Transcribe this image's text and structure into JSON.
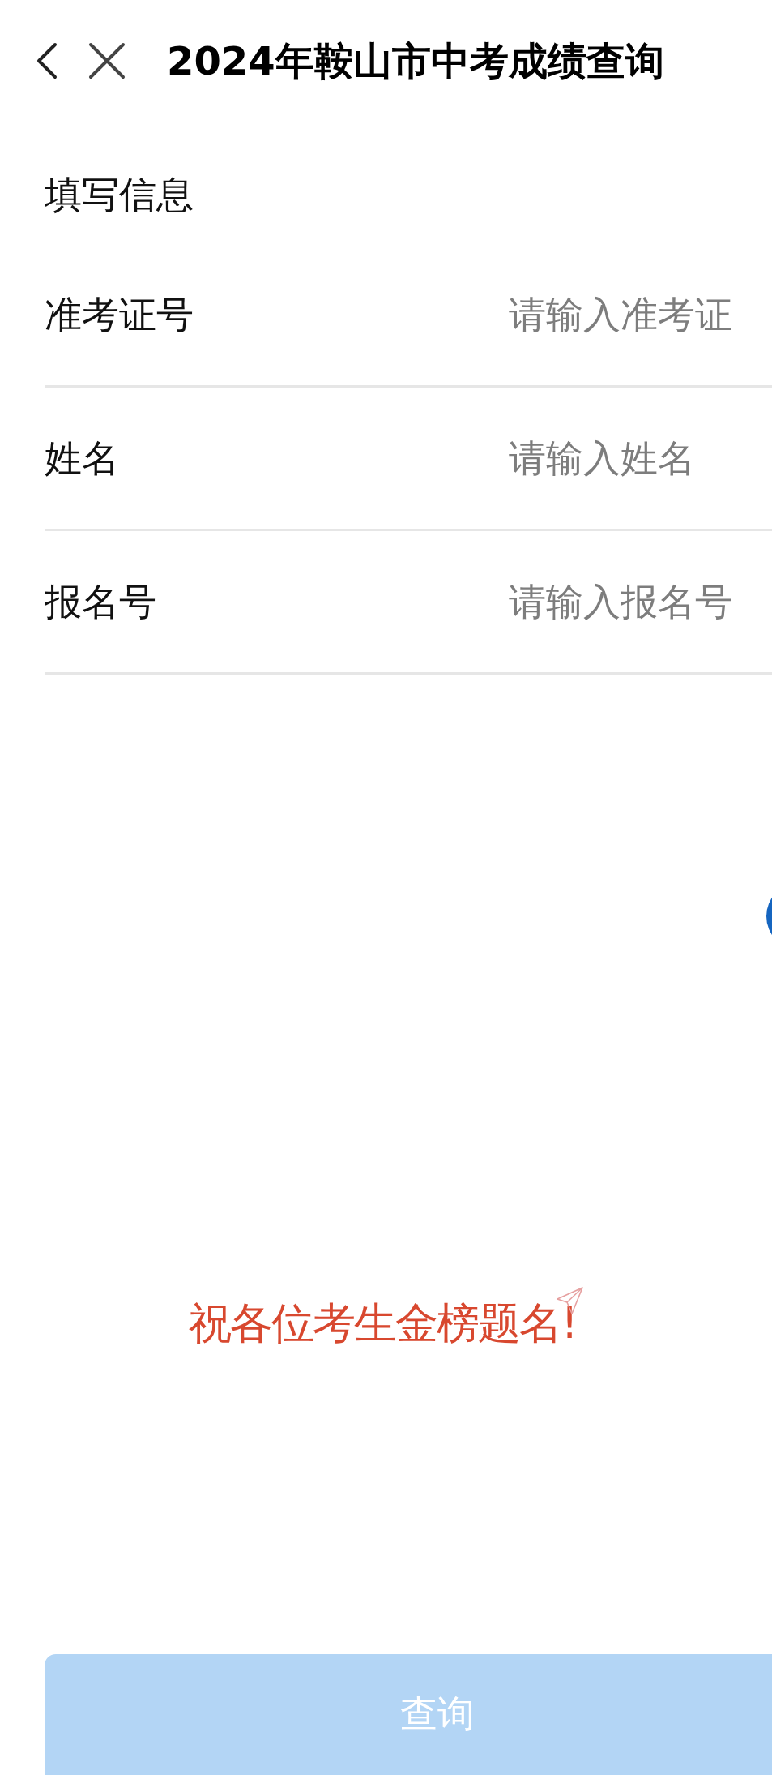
{
  "title": "2024年鞍山市中考成绩查询",
  "section_title": "填写信息",
  "fields": [
    {
      "label": "准考证号",
      "placeholder": "请输入准考证"
    },
    {
      "label": "姓名",
      "placeholder": "请输入姓名"
    },
    {
      "label": "报名号",
      "placeholder": "请输入报名号"
    }
  ],
  "banner": "祝各位考生金榜题名!",
  "submit_button": {
    "label": "查询",
    "disabled": true
  }
}
